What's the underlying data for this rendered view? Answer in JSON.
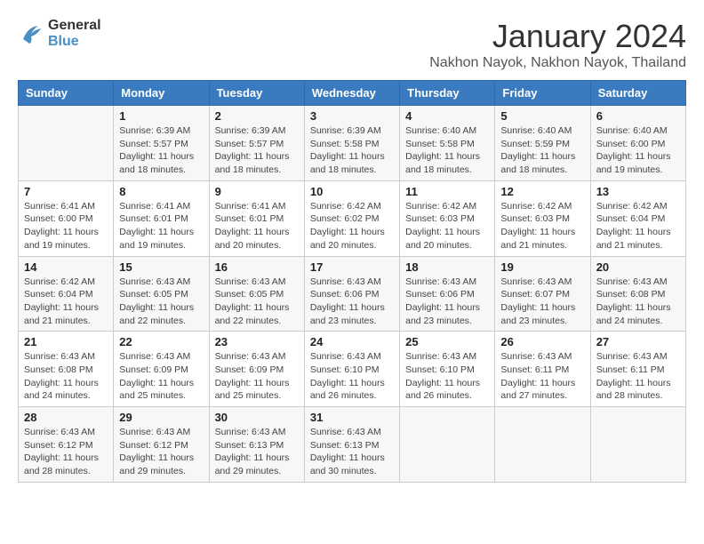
{
  "header": {
    "logo_line1": "General",
    "logo_line2": "Blue",
    "month": "January 2024",
    "location": "Nakhon Nayok, Nakhon Nayok, Thailand"
  },
  "weekdays": [
    "Sunday",
    "Monday",
    "Tuesday",
    "Wednesday",
    "Thursday",
    "Friday",
    "Saturday"
  ],
  "weeks": [
    [
      {
        "day": "",
        "info": ""
      },
      {
        "day": "1",
        "info": "Sunrise: 6:39 AM\nSunset: 5:57 PM\nDaylight: 11 hours and 18 minutes."
      },
      {
        "day": "2",
        "info": "Sunrise: 6:39 AM\nSunset: 5:57 PM\nDaylight: 11 hours and 18 minutes."
      },
      {
        "day": "3",
        "info": "Sunrise: 6:39 AM\nSunset: 5:58 PM\nDaylight: 11 hours and 18 minutes."
      },
      {
        "day": "4",
        "info": "Sunrise: 6:40 AM\nSunset: 5:58 PM\nDaylight: 11 hours and 18 minutes."
      },
      {
        "day": "5",
        "info": "Sunrise: 6:40 AM\nSunset: 5:59 PM\nDaylight: 11 hours and 18 minutes."
      },
      {
        "day": "6",
        "info": "Sunrise: 6:40 AM\nSunset: 6:00 PM\nDaylight: 11 hours and 19 minutes."
      }
    ],
    [
      {
        "day": "7",
        "info": "Sunrise: 6:41 AM\nSunset: 6:00 PM\nDaylight: 11 hours and 19 minutes."
      },
      {
        "day": "8",
        "info": "Sunrise: 6:41 AM\nSunset: 6:01 PM\nDaylight: 11 hours and 19 minutes."
      },
      {
        "day": "9",
        "info": "Sunrise: 6:41 AM\nSunset: 6:01 PM\nDaylight: 11 hours and 20 minutes."
      },
      {
        "day": "10",
        "info": "Sunrise: 6:42 AM\nSunset: 6:02 PM\nDaylight: 11 hours and 20 minutes."
      },
      {
        "day": "11",
        "info": "Sunrise: 6:42 AM\nSunset: 6:03 PM\nDaylight: 11 hours and 20 minutes."
      },
      {
        "day": "12",
        "info": "Sunrise: 6:42 AM\nSunset: 6:03 PM\nDaylight: 11 hours and 21 minutes."
      },
      {
        "day": "13",
        "info": "Sunrise: 6:42 AM\nSunset: 6:04 PM\nDaylight: 11 hours and 21 minutes."
      }
    ],
    [
      {
        "day": "14",
        "info": "Sunrise: 6:42 AM\nSunset: 6:04 PM\nDaylight: 11 hours and 21 minutes."
      },
      {
        "day": "15",
        "info": "Sunrise: 6:43 AM\nSunset: 6:05 PM\nDaylight: 11 hours and 22 minutes."
      },
      {
        "day": "16",
        "info": "Sunrise: 6:43 AM\nSunset: 6:05 PM\nDaylight: 11 hours and 22 minutes."
      },
      {
        "day": "17",
        "info": "Sunrise: 6:43 AM\nSunset: 6:06 PM\nDaylight: 11 hours and 23 minutes."
      },
      {
        "day": "18",
        "info": "Sunrise: 6:43 AM\nSunset: 6:06 PM\nDaylight: 11 hours and 23 minutes."
      },
      {
        "day": "19",
        "info": "Sunrise: 6:43 AM\nSunset: 6:07 PM\nDaylight: 11 hours and 23 minutes."
      },
      {
        "day": "20",
        "info": "Sunrise: 6:43 AM\nSunset: 6:08 PM\nDaylight: 11 hours and 24 minutes."
      }
    ],
    [
      {
        "day": "21",
        "info": "Sunrise: 6:43 AM\nSunset: 6:08 PM\nDaylight: 11 hours and 24 minutes."
      },
      {
        "day": "22",
        "info": "Sunrise: 6:43 AM\nSunset: 6:09 PM\nDaylight: 11 hours and 25 minutes."
      },
      {
        "day": "23",
        "info": "Sunrise: 6:43 AM\nSunset: 6:09 PM\nDaylight: 11 hours and 25 minutes."
      },
      {
        "day": "24",
        "info": "Sunrise: 6:43 AM\nSunset: 6:10 PM\nDaylight: 11 hours and 26 minutes."
      },
      {
        "day": "25",
        "info": "Sunrise: 6:43 AM\nSunset: 6:10 PM\nDaylight: 11 hours and 26 minutes."
      },
      {
        "day": "26",
        "info": "Sunrise: 6:43 AM\nSunset: 6:11 PM\nDaylight: 11 hours and 27 minutes."
      },
      {
        "day": "27",
        "info": "Sunrise: 6:43 AM\nSunset: 6:11 PM\nDaylight: 11 hours and 28 minutes."
      }
    ],
    [
      {
        "day": "28",
        "info": "Sunrise: 6:43 AM\nSunset: 6:12 PM\nDaylight: 11 hours and 28 minutes."
      },
      {
        "day": "29",
        "info": "Sunrise: 6:43 AM\nSunset: 6:12 PM\nDaylight: 11 hours and 29 minutes."
      },
      {
        "day": "30",
        "info": "Sunrise: 6:43 AM\nSunset: 6:13 PM\nDaylight: 11 hours and 29 minutes."
      },
      {
        "day": "31",
        "info": "Sunrise: 6:43 AM\nSunset: 6:13 PM\nDaylight: 11 hours and 30 minutes."
      },
      {
        "day": "",
        "info": ""
      },
      {
        "day": "",
        "info": ""
      },
      {
        "day": "",
        "info": ""
      }
    ]
  ]
}
